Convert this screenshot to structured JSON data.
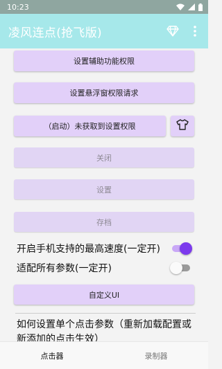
{
  "status_bar": {
    "time": "10:23"
  },
  "app_bar": {
    "title": "凌风连点(抢飞版)"
  },
  "buttons": {
    "accessibility": "设置辅助功能权限",
    "overlay": "设置悬浮窗权限请求",
    "start_status": "（启动）未获取到设置权限",
    "close": "关闭",
    "settings": "设置",
    "save": "存档",
    "custom_ui": "自定义UI"
  },
  "toggles": {
    "max_speed": {
      "label": "开启手机支持的最高速度(一定开)",
      "state": "on"
    },
    "all_params": {
      "label": "适配所有参数(一定开)",
      "state": "off"
    }
  },
  "help": {
    "text": "如何设置单个点击参数（重新加载配置或新添加的点击生效）"
  },
  "bottom_nav": {
    "clicker": "点击器",
    "recorder": "录制器"
  },
  "colors": {
    "status_bar": "#8fa6a0",
    "app_bar": "#a6e8ea",
    "button": "#e2d0f9",
    "accent": "#7c3aed"
  }
}
